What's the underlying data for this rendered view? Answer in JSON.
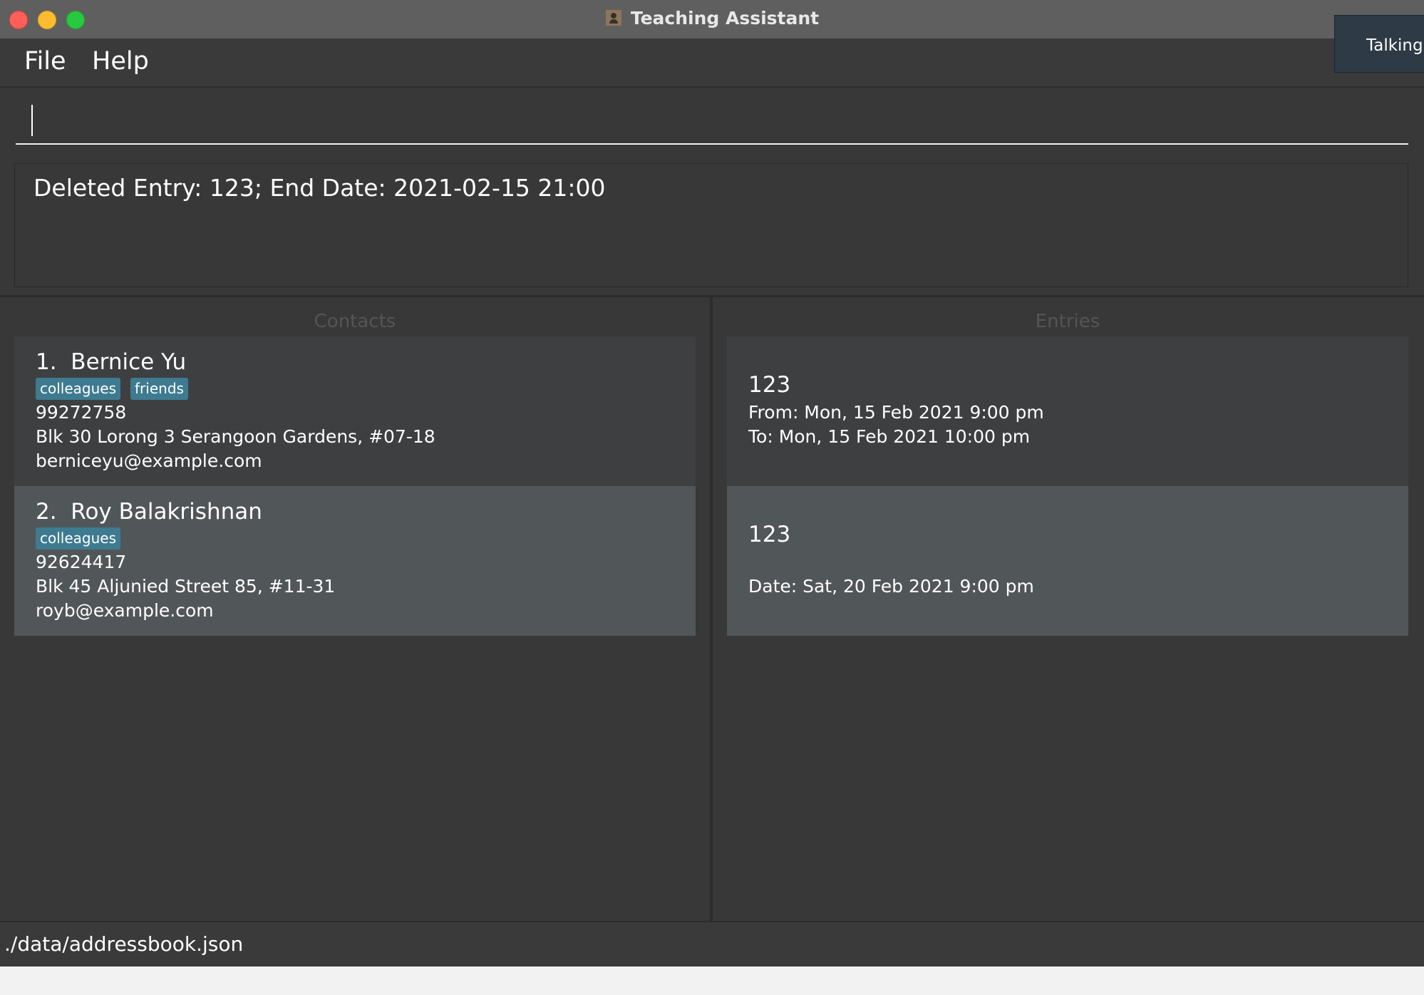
{
  "window": {
    "title": "Teaching Assistant"
  },
  "notification": {
    "text": "Talking"
  },
  "menu": {
    "file_label": "File",
    "help_label": "Help"
  },
  "command": {
    "value": ""
  },
  "result": {
    "text": "Deleted Entry: 123; End Date: 2021-02-15 21:00"
  },
  "contacts": {
    "header": "Contacts",
    "items": [
      {
        "index": "1.",
        "name": "Bernice Yu",
        "tags": [
          "colleagues",
          "friends"
        ],
        "phone": "99272758",
        "address": "Blk 30 Lorong 3 Serangoon Gardens, #07-18",
        "email": "berniceyu@example.com"
      },
      {
        "index": "2.",
        "name": "Roy Balakrishnan",
        "tags": [
          "colleagues"
        ],
        "phone": "92624417",
        "address": "Blk 45 Aljunied Street 85, #11-31",
        "email": "royb@example.com"
      }
    ]
  },
  "entries": {
    "header": "Entries",
    "items": [
      {
        "name": "123",
        "from": "From: Mon, 15 Feb 2021 9:00 pm",
        "to": "To: Mon, 15 Feb 2021 10:00 pm"
      },
      {
        "name": "123",
        "date": "Date: Sat, 20 Feb 2021 9:00 pm"
      }
    ]
  },
  "status": {
    "path": "./data/addressbook.json"
  },
  "colors": {
    "background": "#383838",
    "titlebar": "#5f5f5f",
    "card_dark": "#3e3f41",
    "card_selected": "#515658",
    "tag": "#3e7b91",
    "close": "#ff5f57",
    "minimize": "#febc2e",
    "maximize": "#28c840"
  }
}
